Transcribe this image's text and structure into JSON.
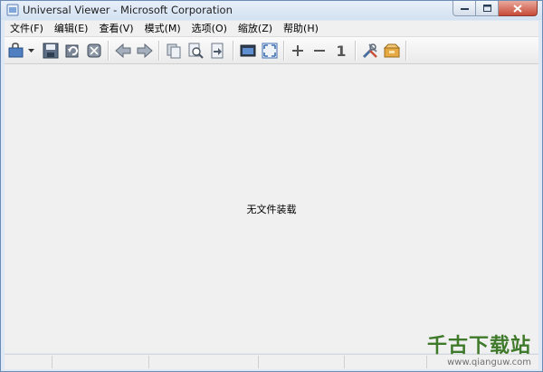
{
  "window": {
    "title": "Universal Viewer - Microsoft Corporation"
  },
  "menu": [
    {
      "label": "文件(F)"
    },
    {
      "label": "编辑(E)"
    },
    {
      "label": "查看(V)"
    },
    {
      "label": "模式(M)"
    },
    {
      "label": "选项(O)"
    },
    {
      "label": "缩放(Z)"
    },
    {
      "label": "帮助(H)"
    }
  ],
  "toolbar": {
    "items": [
      "open-folder-icon",
      "dropdown-arrow-icon",
      "save-icon",
      "reload-icon",
      "delete-icon",
      "back-arrow-icon",
      "forward-arrow-icon",
      "copy-icon",
      "find-icon",
      "export-icon",
      "window-icon",
      "fullscreen-icon",
      "zoom-in-icon",
      "zoom-out-icon",
      "actual-size-icon",
      "tools-icon",
      "package-icon"
    ],
    "actual_size_label": "1",
    "accent": "#3d6fb0"
  },
  "content": {
    "empty_message": "无文件装载"
  },
  "watermark": {
    "main": "千古下载站",
    "sub": "www.qianguw.com",
    "color": "#3f7a2b"
  }
}
